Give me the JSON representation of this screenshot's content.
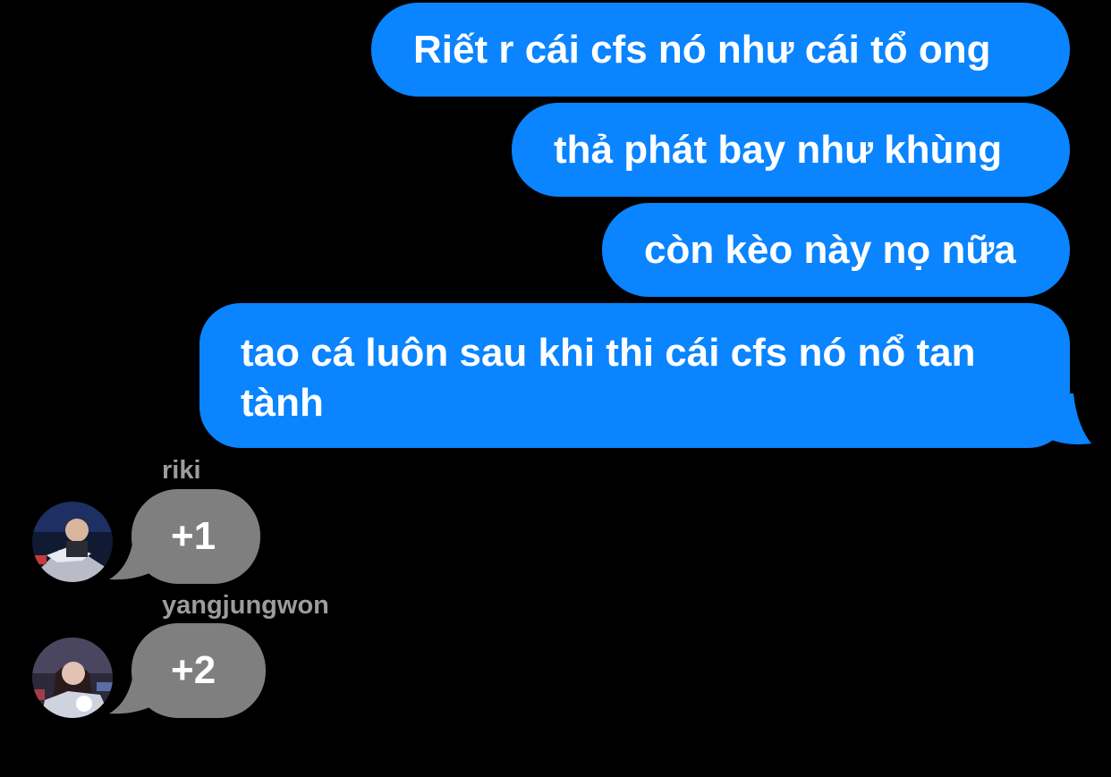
{
  "conversation": {
    "outgoing_color": "#0A84FF",
    "incoming_color": "#7F7F7F",
    "name_color": "#9C9C9C",
    "outgoing": [
      {
        "text": "Riết r cái cfs nó như cái tổ ong"
      },
      {
        "text": "thả phát bay như khùng"
      },
      {
        "text": "còn kèo này nọ nữa"
      },
      {
        "text": "tao cá luôn sau khi thi cái cfs nó nổ tan tành"
      }
    ],
    "incoming": [
      {
        "sender": "riki",
        "text": "+1"
      },
      {
        "sender": "yangjungwon",
        "text": "+2"
      }
    ]
  }
}
